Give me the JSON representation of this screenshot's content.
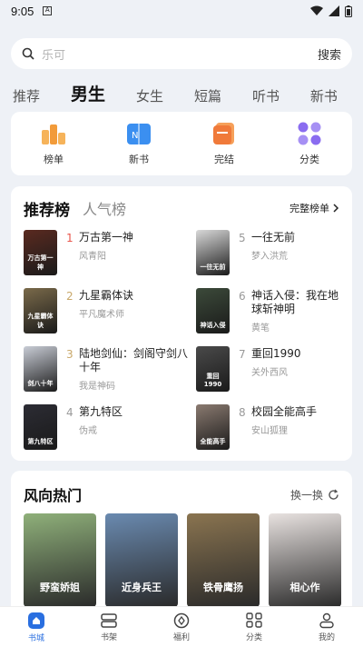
{
  "status_bar": {
    "time": "9:05",
    "notif": "A"
  },
  "search": {
    "placeholder": "乐可",
    "button": "搜索"
  },
  "tabs": [
    "推荐",
    "男生",
    "女生",
    "短篇",
    "听书",
    "新书"
  ],
  "active_tab": "男生",
  "quick_links": [
    {
      "label": "榜单",
      "icon": "chart-bars-icon",
      "color": "#f29b3a"
    },
    {
      "label": "新书",
      "icon": "new-book-icon",
      "color": "#3b8ff0"
    },
    {
      "label": "完结",
      "icon": "stack-icon",
      "color": "#f07a3a"
    },
    {
      "label": "分类",
      "icon": "grid-icon",
      "color": "#8a6cf0"
    }
  ],
  "rank": {
    "tab_active": "推荐榜",
    "tab_other": "人气榜",
    "more": "完整榜单",
    "items": [
      {
        "rank": "1",
        "title": "万古第一神",
        "author": "风青阳",
        "cover_color": "#5a2a20",
        "cover_text": "万古第一神"
      },
      {
        "rank": "5",
        "title": "一往无前",
        "author": "梦入洪荒",
        "cover_color": "#d9d9d9",
        "cover_text": "一往无前"
      },
      {
        "rank": "2",
        "title": "九星霸体诀",
        "author": "平凡魔术师",
        "cover_color": "#7a6a4a",
        "cover_text": "九星霸体诀"
      },
      {
        "rank": "6",
        "title": "神话入侵：我在地球斩神明",
        "author": "黄笔",
        "cover_color": "#3c4a3a",
        "cover_text": "神话入侵"
      },
      {
        "rank": "3",
        "title": "陆地剑仙：剑阁守剑八十年",
        "author": "我是神码",
        "cover_color": "#c9cdd6",
        "cover_text": "剑八十年"
      },
      {
        "rank": "7",
        "title": "重回1990",
        "author": "关外西风",
        "cover_color": "#4a4a4a",
        "cover_text": "重回1990"
      },
      {
        "rank": "4",
        "title": "第九特区",
        "author": "伪戒",
        "cover_color": "#2c2c34",
        "cover_text": "第九特区"
      },
      {
        "rank": "8",
        "title": "校园全能高手",
        "author": "安山狐狸",
        "cover_color": "#8a7a70",
        "cover_text": "全能高手"
      }
    ]
  },
  "hot": {
    "title": "风向热门",
    "refresh": "换一换",
    "covers": [
      {
        "text": "野蛮娇姐",
        "color": "#8fb07a"
      },
      {
        "text": "近身兵王",
        "color": "#6a8ab0"
      },
      {
        "text": "铁骨鹰扬",
        "color": "#8a7450"
      },
      {
        "text": "相心作",
        "color": "#e8e2e0"
      }
    ]
  },
  "bottom_nav": [
    {
      "label": "书城",
      "icon": "home-icon",
      "active": true
    },
    {
      "label": "书架",
      "icon": "shelf-icon",
      "active": false
    },
    {
      "label": "福利",
      "icon": "gift-icon",
      "active": false
    },
    {
      "label": "分类",
      "icon": "category-icon",
      "active": false
    },
    {
      "label": "我的",
      "icon": "profile-icon",
      "active": false
    }
  ],
  "colors": {
    "accent": "#2a6fe0",
    "rank_top": "#e8544a",
    "rank_other": "#c9a86a"
  }
}
